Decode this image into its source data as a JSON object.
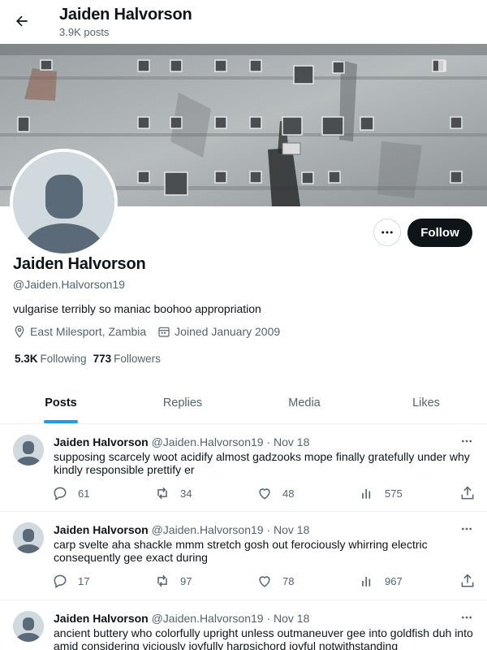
{
  "header": {
    "name": "Jaiden Halvorson",
    "post_count": "3.9K posts"
  },
  "profile": {
    "name": "Jaiden Halvorson",
    "handle": "@Jaiden.Halvorson19",
    "bio": "vulgarise terribly so maniac boohoo appropriation",
    "location": "East Milesport, Zambia",
    "joined": "Joined January 2009",
    "following_count": "5.3K",
    "following_label": "Following",
    "followers_count": "773",
    "followers_label": "Followers",
    "follow_label": "Follow"
  },
  "tabs": [
    {
      "label": "Posts",
      "active": true
    },
    {
      "label": "Replies",
      "active": false
    },
    {
      "label": "Media",
      "active": false
    },
    {
      "label": "Likes",
      "active": false
    }
  ],
  "posts": [
    {
      "name": "Jaiden Halvorson",
      "handle": "@Jaiden.Halvorson19",
      "sep": "·",
      "date": "Nov 18",
      "text": "supposing scarcely woot acidify almost gadzooks mope finally gratefully under why kindly responsible prettify er",
      "replies": "61",
      "reposts": "34",
      "likes": "48",
      "views": "575"
    },
    {
      "name": "Jaiden Halvorson",
      "handle": "@Jaiden.Halvorson19",
      "sep": "·",
      "date": "Nov 18",
      "text": "carp svelte aha shackle mmm stretch gosh out ferociously whirring electric consequently gee exact during",
      "replies": "17",
      "reposts": "97",
      "likes": "78",
      "views": "967"
    },
    {
      "name": "Jaiden Halvorson",
      "handle": "@Jaiden.Halvorson19",
      "sep": "·",
      "date": "Nov 18",
      "text": "ancient buttery who colorfully upright unless outmaneuver gee into goldfish duh into amid considering viciously joyfully harpsichord joyful notwithstanding",
      "replies": "",
      "reposts": "",
      "likes": "",
      "views": ""
    }
  ],
  "colors": {
    "accent": "#1d9bf0",
    "text": "#0f1419",
    "secondary": "#536471",
    "follow_bg": "#0f1419"
  },
  "icons": {
    "back": "arrow-left-icon",
    "more": "more-horizontal-icon",
    "location": "location-pin-icon",
    "calendar": "calendar-icon",
    "reply": "reply-icon",
    "repost": "repost-icon",
    "like": "heart-icon",
    "views": "views-bar-icon",
    "share": "share-icon"
  }
}
